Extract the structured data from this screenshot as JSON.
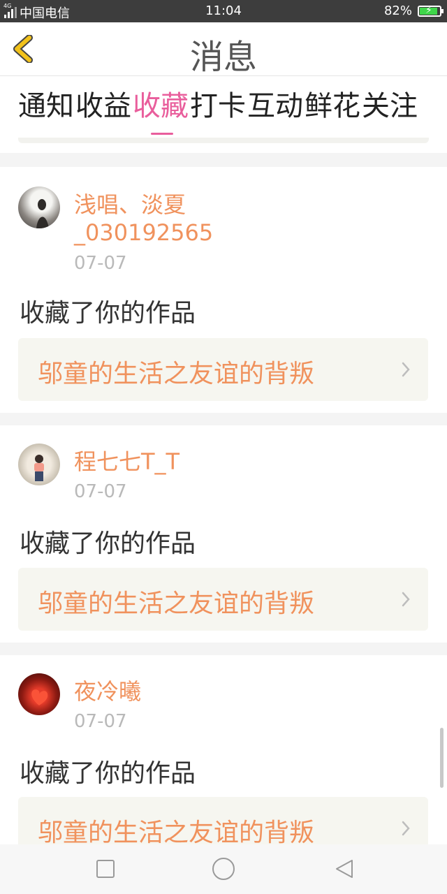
{
  "status_bar": {
    "network": "4G",
    "carrier": "中国电信",
    "time": "11:04",
    "battery": "82%",
    "battery_level": 0.82
  },
  "header": {
    "title": "消息"
  },
  "tabs": [
    {
      "label": "通知"
    },
    {
      "label": "收益"
    },
    {
      "label": "收藏",
      "active": true
    },
    {
      "label": "打卡"
    },
    {
      "label": "互动"
    },
    {
      "label": "鲜花"
    },
    {
      "label": "关注"
    }
  ],
  "messages": [
    {
      "username_line1": "浅唱、淡夏",
      "username_line2": "_030192565",
      "date": "07-07",
      "action": "收藏了你的作品",
      "work_title": "邬童的生活之友谊的背叛"
    },
    {
      "username_line1": "程七七T_T",
      "date": "07-07",
      "action": "收藏了你的作品",
      "work_title": "邬童的生活之友谊的背叛"
    },
    {
      "username_line1": "夜冷曦",
      "date": "07-07",
      "action": "收藏了你的作品",
      "work_title": "邬童的生活之友谊的背叛"
    }
  ],
  "colors": {
    "accent_pink": "#e95e9c",
    "username_orange": "#f0925d",
    "back_arrow_yellow": "#f2c21b"
  }
}
